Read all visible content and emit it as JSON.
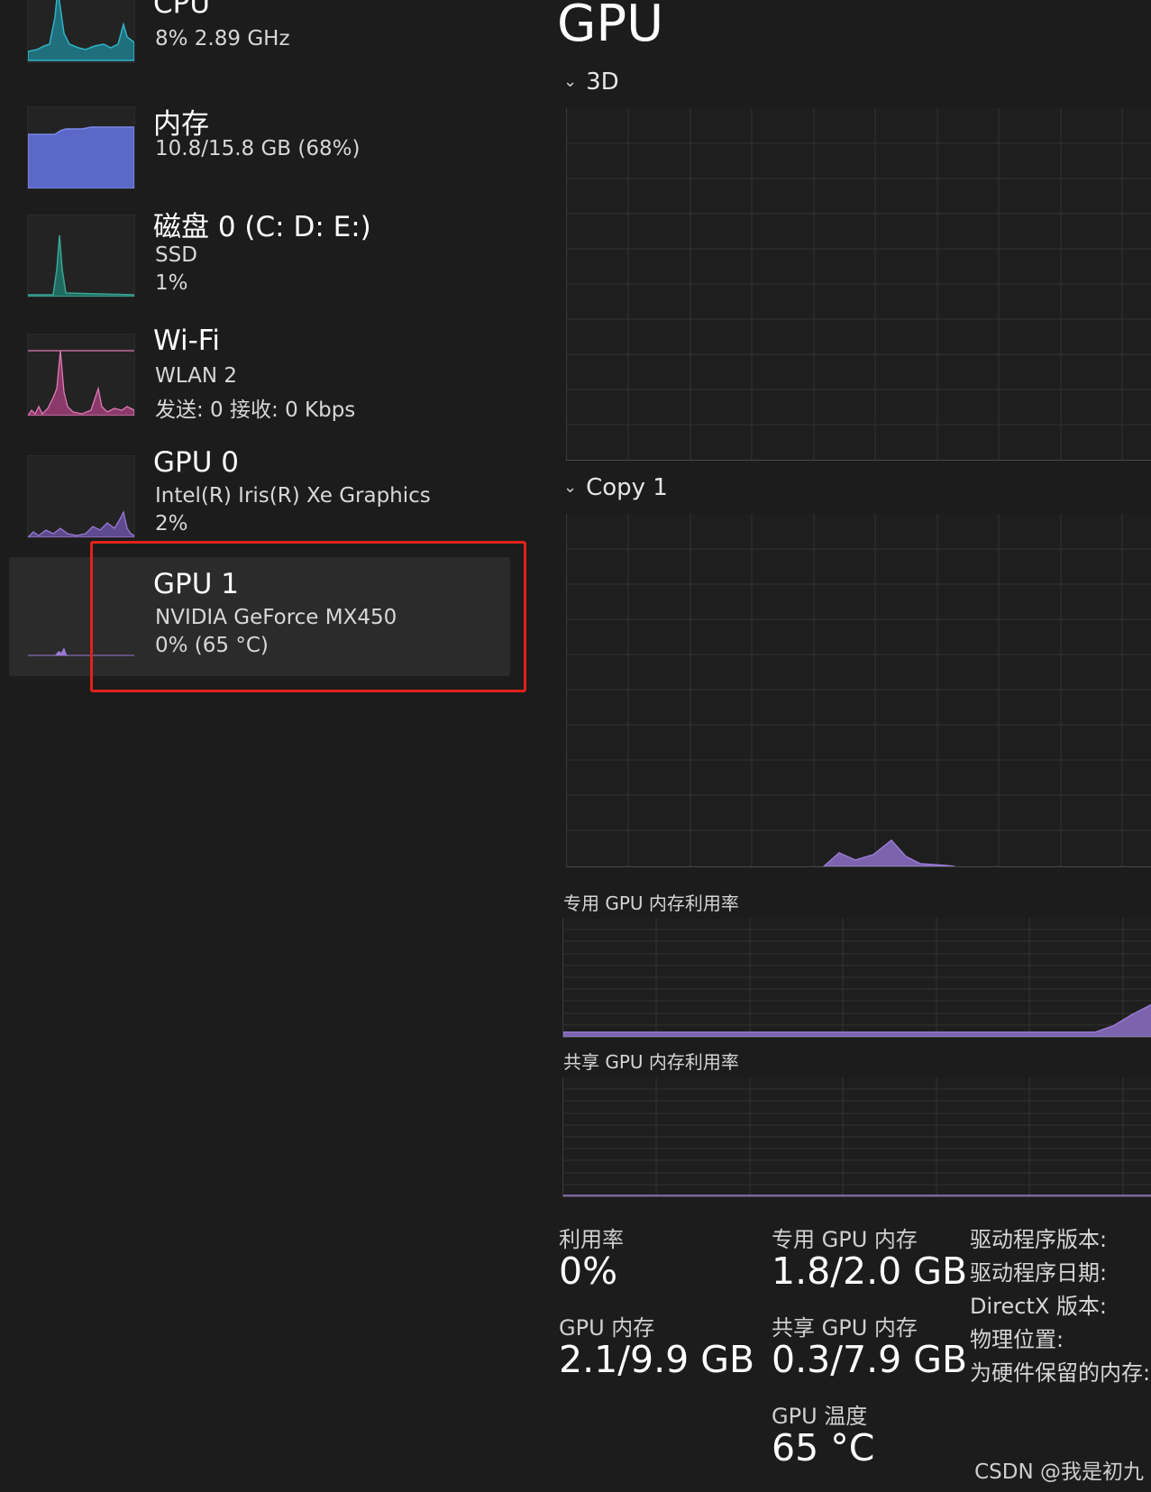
{
  "sidebar": {
    "items": [
      {
        "title": "CPU",
        "sub1": "8%  2.89 GHz",
        "sub2": ""
      },
      {
        "title": "内存",
        "sub1": "10.8/15.8 GB (68%)",
        "sub2": ""
      },
      {
        "title": "磁盘 0 (C: D: E:)",
        "sub1": "SSD",
        "sub2": "1%"
      },
      {
        "title": "Wi-Fi",
        "sub1": "WLAN 2",
        "sub2": "发送: 0  接收: 0 Kbps"
      },
      {
        "title": "GPU 0",
        "sub1": "Intel(R) Iris(R) Xe Graphics",
        "sub2": "2%"
      },
      {
        "title": "GPU 1",
        "sub1": "NVIDIA GeForce MX450",
        "sub2": "0%  (65 °C)"
      }
    ]
  },
  "main": {
    "title": "GPU",
    "sections": [
      "3D",
      "Copy 1"
    ],
    "dedicated_mem_label": "专用 GPU 内存利用率",
    "shared_mem_label": "共享 GPU 内存利用率",
    "stats": {
      "utilization_label": "利用率",
      "utilization_value": "0%",
      "gpu_mem_label": "GPU 内存",
      "gpu_mem_value": "2.1/9.9 GB",
      "dedicated_label": "专用 GPU 内存",
      "dedicated_value": "1.8/2.0 GB",
      "shared_label": "共享 GPU 内存",
      "shared_value": "0.3/7.9 GB",
      "temp_label": "GPU 温度",
      "temp_value": "65 °C"
    },
    "details": [
      "驱动程序版本:",
      "驱动程序日期:",
      "DirectX 版本:",
      "物理位置:",
      "为硬件保留的内存:"
    ]
  },
  "watermark": "CSDN @我是初九",
  "colors": {
    "cpu": "#2fb3c8",
    "memory": "#6b79d6",
    "disk": "#3aa597",
    "wifi": "#e07ab4",
    "gpu": "#9a7ad4",
    "highlight": "#e0221b"
  }
}
